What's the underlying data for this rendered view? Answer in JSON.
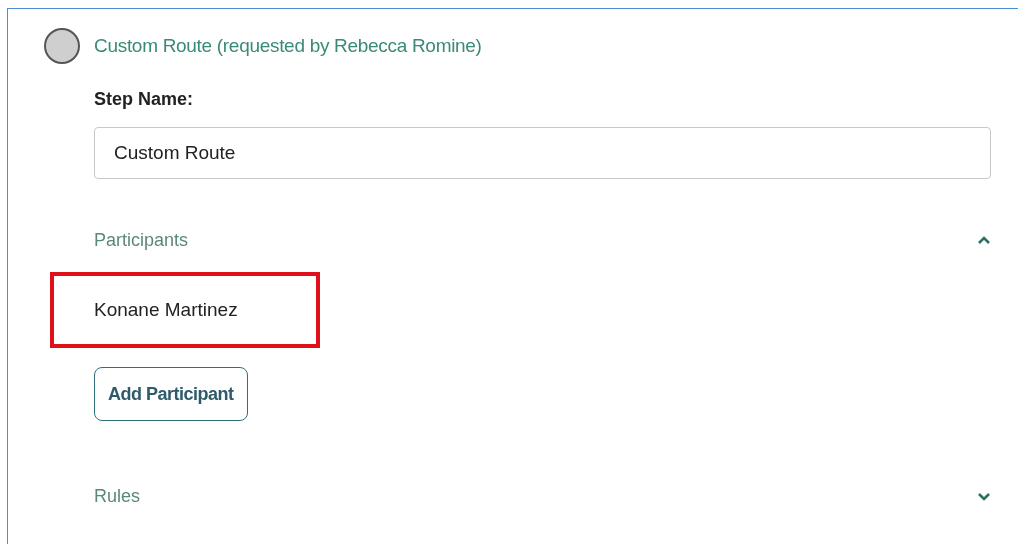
{
  "step": {
    "title": "Custom Route (requested by Rebecca Romine)",
    "name_label": "Step Name:",
    "name_value": "Custom Route"
  },
  "sections": [
    {
      "title": "Participants",
      "expanded": true,
      "participants": [
        {
          "name": "Konane Martinez",
          "highlighted": true
        }
      ],
      "add_button": "Add Participant"
    },
    {
      "title": "Rules",
      "expanded": false
    }
  ]
}
